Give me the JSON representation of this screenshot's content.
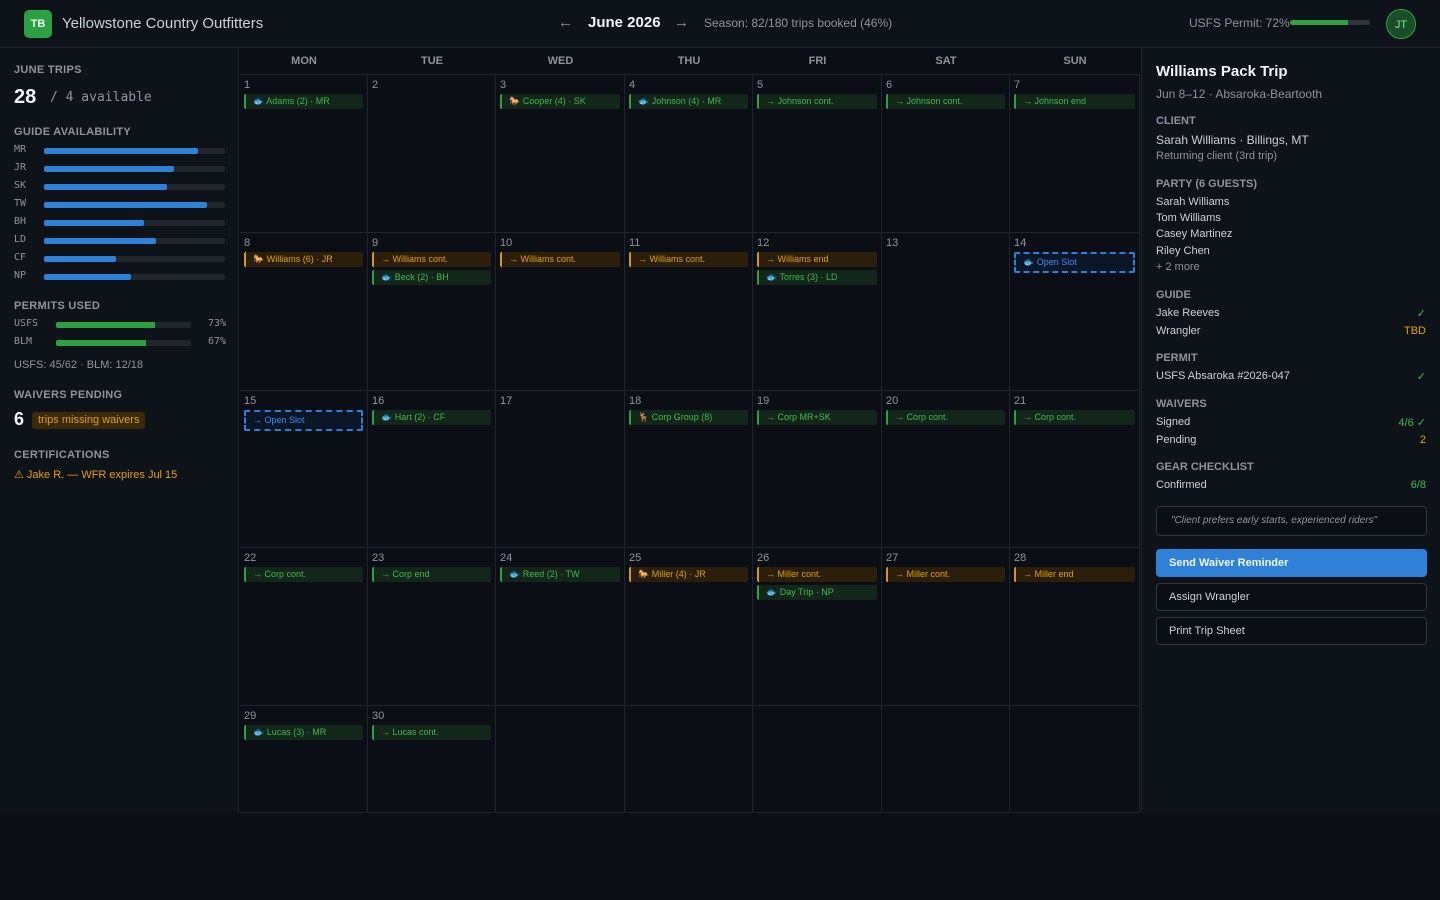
{
  "header": {
    "logo": "TB",
    "title": "Yellowstone Country Outfitters",
    "prev": "←",
    "month": "June 2026",
    "next": "→",
    "season": "Season: 82/180 trips booked (46%)",
    "permit_label": "USFS Permit: 72%",
    "permit_fraction": 0.72,
    "avatar": "JT"
  },
  "sidebar": {
    "trips_title": "JUNE TRIPS",
    "trips_count": "28",
    "trips_avail": "/ 4 available",
    "guide_title": "GUIDE AVAILABILITY",
    "guides": [
      {
        "code": "MR",
        "fraction": 0.85
      },
      {
        "code": "JR",
        "fraction": 0.72
      },
      {
        "code": "SK",
        "fraction": 0.68
      },
      {
        "code": "TW",
        "fraction": 0.9
      },
      {
        "code": "BH",
        "fraction": 0.55
      },
      {
        "code": "LD",
        "fraction": 0.62
      },
      {
        "code": "CF",
        "fraction": 0.4
      },
      {
        "code": "NP",
        "fraction": 0.48
      }
    ],
    "permits_title": "PERMITS USED",
    "permits": [
      {
        "code": "USFS",
        "pct": "73%",
        "fraction": 0.73
      },
      {
        "code": "BLM",
        "pct": "67%",
        "fraction": 0.67
      }
    ],
    "permits_summary": "USFS: 45/62 · BLM: 12/18",
    "waivers_title": "WAIVERS PENDING",
    "waivers_count": "6",
    "waivers_badge": "trips missing waivers",
    "cert_title": "CERTIFICATIONS",
    "cert_warning": "⚠ Jake R. — WFR expires Jul 15"
  },
  "calendar": {
    "weekdays": [
      "MON",
      "TUE",
      "WED",
      "THU",
      "FRI",
      "SAT",
      "SUN"
    ],
    "weeks": [
      [
        {
          "day": "1",
          "events": [
            {
              "text": "🐟 Adams (2) · MR",
              "type": "g"
            }
          ]
        },
        {
          "day": "2",
          "events": []
        },
        {
          "day": "3",
          "events": [
            {
              "text": "🐎 Cooper (4) · SK",
              "type": "g"
            }
          ]
        },
        {
          "day": "4",
          "events": [
            {
              "text": "🐟 Johnson (4) · MR",
              "type": "g"
            }
          ]
        },
        {
          "day": "5",
          "events": [
            {
              "text": "→ Johnson cont.",
              "type": "g"
            }
          ]
        },
        {
          "day": "6",
          "events": [
            {
              "text": "→ Johnson cont.",
              "type": "g"
            }
          ]
        },
        {
          "day": "7",
          "events": [
            {
              "text": "→ Johnson end",
              "type": "g"
            }
          ]
        }
      ],
      [
        {
          "day": "8",
          "events": [
            {
              "text": "🐎 Williams (6) · JR",
              "type": "o"
            }
          ]
        },
        {
          "day": "9",
          "events": [
            {
              "text": "→ Williams cont.",
              "type": "o"
            },
            {
              "text": "🐟 Beck (2) · BH",
              "type": "g"
            }
          ]
        },
        {
          "day": "10",
          "events": [
            {
              "text": "→ Williams cont.",
              "type": "o"
            }
          ]
        },
        {
          "day": "11",
          "events": [
            {
              "text": "→ Williams cont.",
              "type": "o"
            }
          ]
        },
        {
          "day": "12",
          "events": [
            {
              "text": "→ Williams end",
              "type": "o"
            },
            {
              "text": "🐟 Torres (3) · LD",
              "type": "g"
            }
          ]
        },
        {
          "day": "13",
          "events": []
        },
        {
          "day": "14",
          "events": [
            {
              "text": "🐟 Open Slot",
              "type": "b"
            }
          ]
        }
      ],
      [
        {
          "day": "15",
          "events": [
            {
              "text": "→ Open Slot",
              "type": "b"
            }
          ]
        },
        {
          "day": "16",
          "events": [
            {
              "text": "🐟 Hart (2) · CF",
              "type": "g"
            }
          ]
        },
        {
          "day": "17",
          "events": []
        },
        {
          "day": "18",
          "events": [
            {
              "text": "🦌 Corp Group (8)",
              "type": "g"
            }
          ]
        },
        {
          "day": "19",
          "events": [
            {
              "text": "→ Corp MR+SK",
              "type": "g"
            }
          ]
        },
        {
          "day": "20",
          "events": [
            {
              "text": "→ Corp cont.",
              "type": "g"
            }
          ]
        },
        {
          "day": "21",
          "events": [
            {
              "text": "→ Corp cont.",
              "type": "g"
            }
          ]
        }
      ],
      [
        {
          "day": "22",
          "events": [
            {
              "text": "→ Corp cont.",
              "type": "g"
            }
          ]
        },
        {
          "day": "23",
          "events": [
            {
              "text": "→ Corp end",
              "type": "g"
            }
          ]
        },
        {
          "day": "24",
          "events": [
            {
              "text": "🐟 Reed (2) · TW",
              "type": "g"
            }
          ]
        },
        {
          "day": "25",
          "events": [
            {
              "text": "🐎 Miller (4) · JR",
              "type": "o"
            }
          ]
        },
        {
          "day": "26",
          "events": [
            {
              "text": "→ Miller cont.",
              "type": "o"
            },
            {
              "text": "🐟 Day Trip · NP",
              "type": "g"
            }
          ]
        },
        {
          "day": "27",
          "events": [
            {
              "text": "→ Miller cont.",
              "type": "o"
            }
          ]
        },
        {
          "day": "28",
          "events": [
            {
              "text": "→ Miller end",
              "type": "o"
            }
          ]
        }
      ],
      [
        {
          "day": "29",
          "events": [
            {
              "text": "🐟 Lucas (3) · MR",
              "type": "g"
            }
          ]
        },
        {
          "day": "30",
          "events": [
            {
              "text": "→ Lucas cont.",
              "type": "g"
            }
          ]
        },
        {
          "day": "",
          "events": []
        },
        {
          "day": "",
          "events": []
        },
        {
          "day": "",
          "events": []
        },
        {
          "day": "",
          "events": []
        },
        {
          "day": "",
          "events": []
        }
      ]
    ]
  },
  "panel": {
    "title": "Williams Pack Trip",
    "subtitle": "Jun 8–12 · Absaroka-Beartooth",
    "client_title": "CLIENT",
    "client_name": "Sarah Williams · Billings, MT",
    "client_note": "Returning client (3rd trip)",
    "party_title": "PARTY (6 GUESTS)",
    "party": [
      "Sarah Williams",
      "Tom Williams",
      "Casey Martinez",
      "Riley Chen"
    ],
    "party_more": "+ 2 more",
    "guide_title": "GUIDE",
    "guide_name": "Jake Reeves",
    "guide_status": "✓",
    "wrangler_label": "Wrangler",
    "wrangler_status": "TBD",
    "permit_title": "PERMIT",
    "permit_name": "USFS Absaroka #2026-047",
    "permit_status": "✓",
    "waivers_title": "WAIVERS",
    "signed_label": "Signed",
    "signed_value": "4/6 ✓",
    "pending_label": "Pending",
    "pending_value": "2",
    "gear_title": "GEAR CHECKLIST",
    "gear_label": "Confirmed",
    "gear_value": "6/8",
    "note": "\"Client prefers early starts, experienced riders\"",
    "btn_primary": "Send Waiver Reminder",
    "btn_assign": "Assign Wrangler",
    "btn_print": "Print Trip Sheet"
  }
}
